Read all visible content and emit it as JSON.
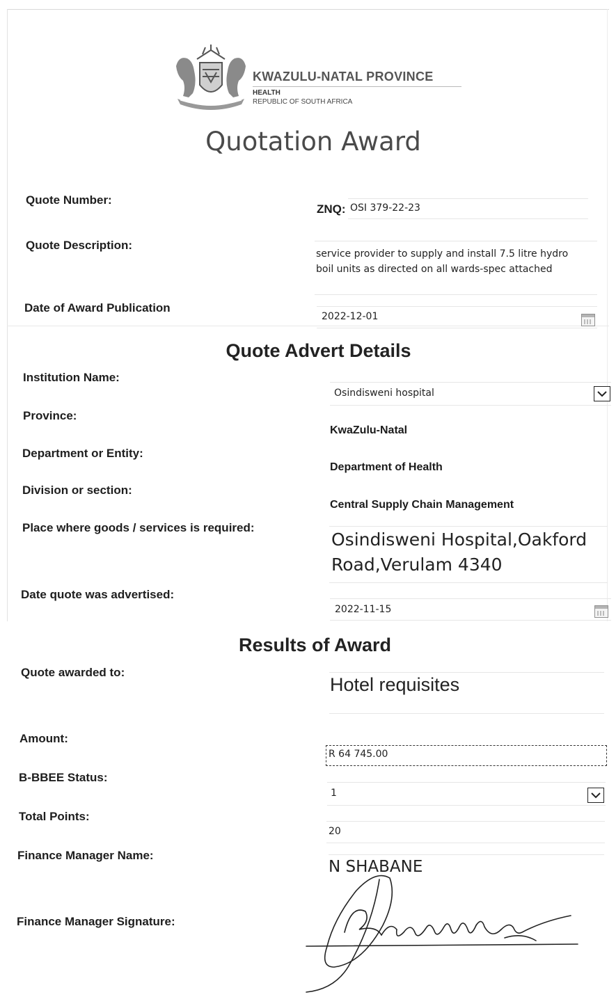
{
  "header": {
    "org_title": "KWAZULU-NATAL PROVINCE",
    "org_sub1": "HEALTH",
    "org_sub2": "REPUBLIC OF SOUTH AFRICA",
    "page_title": "Quotation Award"
  },
  "quote": {
    "number_label": "Quote Number:",
    "number_prefix": "ZNQ:",
    "number_value": "OSI 379-22-23",
    "description_label": "Quote Description:",
    "description_line1": "service provider to supply and install 7.5 litre hydro",
    "description_line2": "boil units as directed on all wards-spec attached",
    "award_date_label": "Date of Award Publication",
    "award_date_value": "2022-12-01"
  },
  "advert": {
    "heading": "Quote Advert Details",
    "institution_label": "Institution Name:",
    "institution_value": "Osindisweni hospital",
    "province_label": "Province:",
    "province_value": "KwaZulu-Natal",
    "department_label": "Department or Entity:",
    "department_value": "Department of Health",
    "division_label": "Division or section:",
    "division_value": "Central Supply Chain Management",
    "place_label": "Place where goods /  services is required:",
    "place_line1": "Osindisweni Hospital,Oakford",
    "place_line2": "Road,Verulam 4340",
    "advertised_label": "Date quote was advertised:",
    "advertised_value": "2022-11-15"
  },
  "results": {
    "heading": "Results of Award",
    "awarded_label": "Quote awarded to:",
    "awarded_value": "Hotel requisites",
    "amount_label": "Amount:",
    "amount_value": "R 64 745.00",
    "bbbee_label": "B-BBEE Status:",
    "bbbee_value": "1",
    "points_label": "Total Points:",
    "points_value": "20",
    "fm_name_label": "Finance Manager Name:",
    "fm_name_value": "N SHABANE",
    "fm_signature_label": "Finance Manager Signature:"
  },
  "icons": {
    "coat_of_arms": "coat-of-arms-icon",
    "calendar": "calendar-icon",
    "dropdown": "chevron-down-icon",
    "signature": "signature-icon"
  }
}
